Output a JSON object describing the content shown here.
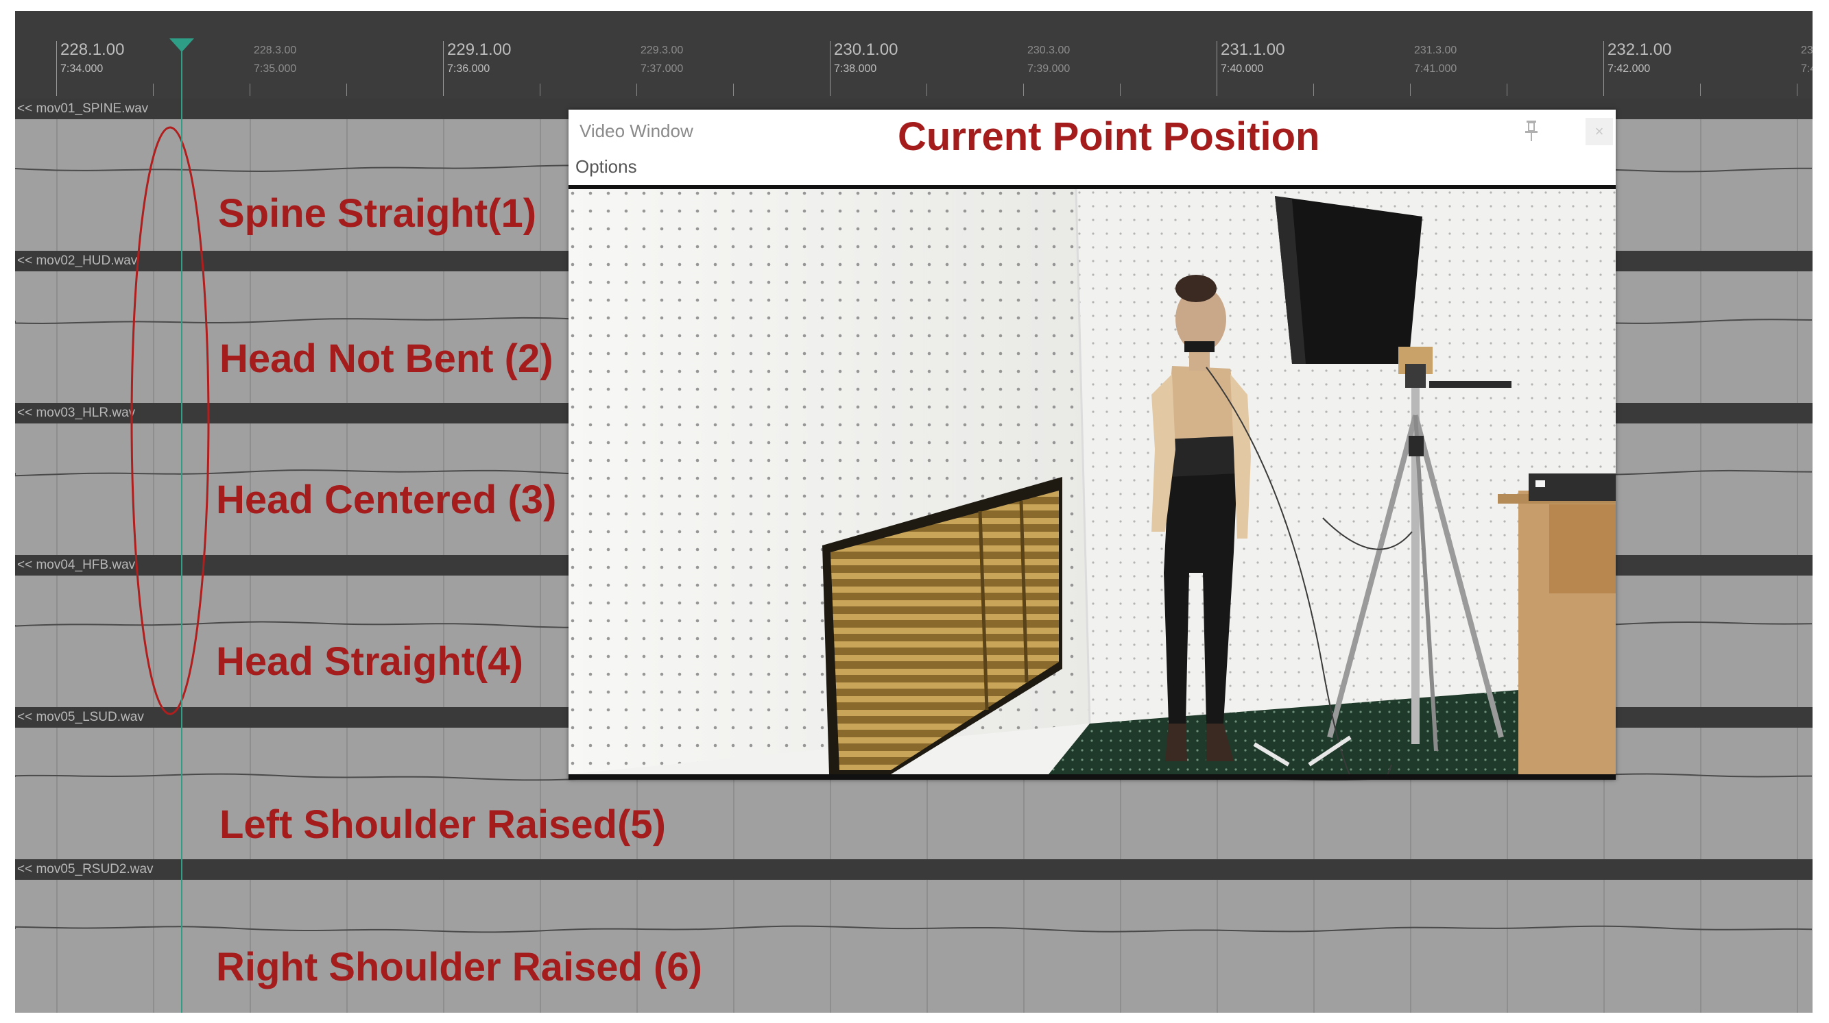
{
  "ruler": {
    "marks": [
      {
        "time": "228.1.00",
        "clock": "7:34.000",
        "major": true
      },
      {
        "time": "228.3.00",
        "clock": "7:35.000",
        "major": false
      },
      {
        "time": "229.1.00",
        "clock": "7:36.000",
        "major": true
      },
      {
        "time": "229.3.00",
        "clock": "7:37.000",
        "major": false
      },
      {
        "time": "230.1.00",
        "clock": "7:38.000",
        "major": true
      },
      {
        "time": "230.3.00",
        "clock": "7:39.000",
        "major": false
      },
      {
        "time": "231.1.00",
        "clock": "7:40.000",
        "major": true
      },
      {
        "time": "231.3.00",
        "clock": "7:41.000",
        "major": false
      },
      {
        "time": "232.1.00",
        "clock": "7:42.000",
        "major": true
      },
      {
        "time": "23",
        "clock": "7:4",
        "major": false
      }
    ]
  },
  "tracks": [
    {
      "name": "<< mov01_SPINE.wav",
      "annotation": "Spine Straight(1)"
    },
    {
      "name": "<< mov02_HUD.wav",
      "annotation": "Head Not Bent (2)"
    },
    {
      "name": "<< mov03_HLR.wav",
      "annotation": "Head Centered  (3)"
    },
    {
      "name": "<< mov04_HFB.wav",
      "annotation": "Head Straight(4)"
    },
    {
      "name": "<< mov05_LSUD.wav",
      "annotation": "Left Shoulder Raised(5)"
    },
    {
      "name": "<< mov05_RSUD2.wav",
      "annotation": "Right Shoulder Raised (6)"
    }
  ],
  "video_window": {
    "title": "Video Window",
    "menu": "Options",
    "heading": "Current Point Position",
    "close_label": "×"
  },
  "icons": {
    "pin": "pin-icon",
    "close": "close-icon",
    "playhead": "playhead-marker-icon"
  },
  "colors": {
    "annotation": "#a51c1c",
    "playhead": "#2f9e86",
    "track_bg": "#a0a0a0",
    "header_bg": "#3a3a3a"
  }
}
